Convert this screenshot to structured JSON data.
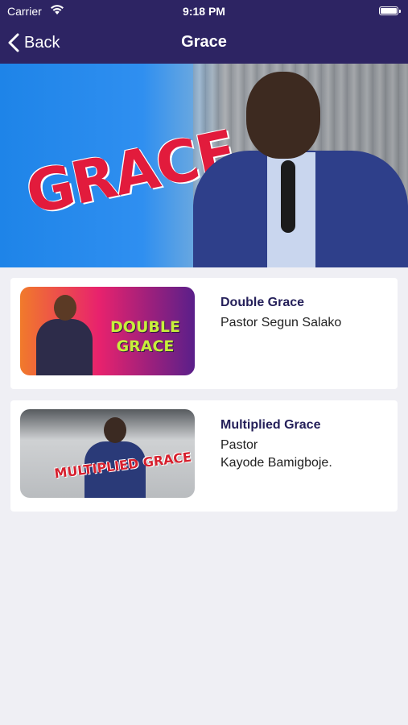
{
  "status_bar": {
    "carrier": "Carrier",
    "time": "9:18 PM",
    "wifi_icon": "wifi-icon",
    "battery_icon": "battery-icon"
  },
  "nav": {
    "back_label": "Back",
    "back_icon": "chevron-left-icon",
    "title": "Grace"
  },
  "hero": {
    "word": "GRACE"
  },
  "items": [
    {
      "title": "Double Grace",
      "subtitle": "Pastor Segun Salako",
      "thumb_text": "DOUBLE GRACE"
    },
    {
      "title": "Multiplied Grace",
      "subtitle": "Pastor\nKayode Bamigboje.",
      "thumb_text": "MULTIPLIED GRACE"
    }
  ],
  "colors": {
    "nav_background": "#2d2463",
    "page_background": "#efeff4",
    "title_text": "#25205a"
  }
}
